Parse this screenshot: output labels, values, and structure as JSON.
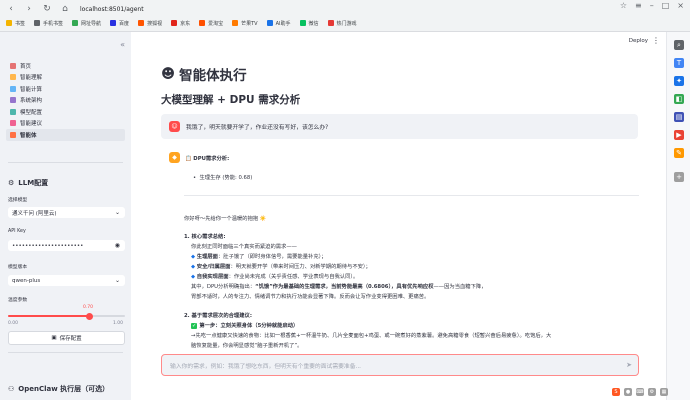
{
  "browser": {
    "url": "localhost:8501/agent",
    "bookmarks": [
      {
        "label": "书签",
        "color": "#f4b400"
      },
      {
        "label": "手机书签",
        "color": "#5f6368"
      },
      {
        "label": "网址导航",
        "color": "#34a853"
      },
      {
        "label": "百度",
        "color": "#2932e1"
      },
      {
        "label": "搜狐视",
        "color": "#ff5500"
      },
      {
        "label": "京东",
        "color": "#e1251b"
      },
      {
        "label": "爱淘宝",
        "color": "#ff5000"
      },
      {
        "label": "芒果TV",
        "color": "#ff7a00"
      },
      {
        "label": "AI助手",
        "color": "#1a73e8"
      },
      {
        "label": "微信",
        "color": "#07c160"
      },
      {
        "label": "热门游戏",
        "color": "#e53935"
      }
    ]
  },
  "sidebar": {
    "nav": [
      {
        "label": "首页",
        "color": "#e57373"
      },
      {
        "label": "智能理解",
        "color": "#ffb74d"
      },
      {
        "label": "智能计算",
        "color": "#64b5f6"
      },
      {
        "label": "系统架构",
        "color": "#9575cd"
      },
      {
        "label": "模型配置",
        "color": "#4db6ac"
      },
      {
        "label": "智能建议",
        "color": "#f06292"
      },
      {
        "label": "智能体",
        "color": "#ff7043"
      }
    ],
    "llm_title": "LLM配置",
    "model_label": "选择模型",
    "model_value": "通义千问 (阿里云)",
    "apikey_label": "API Key",
    "apikey_value": "••••••••••••••••••••••",
    "version_label": "模型版本",
    "version_value": "qwen-plus",
    "temp_label": "温度参数",
    "temp_value": "0.70",
    "temp_min": "0.00",
    "temp_max": "1.00",
    "temp_fraction": 0.7,
    "save_label": "保存配置",
    "openclaw_title": "OpenClaw 执行层（可选）"
  },
  "header": {
    "deploy_label": "Deploy"
  },
  "main": {
    "title": "智能体执行",
    "subtitle": "大模型理解 + DPU 需求分析",
    "user_message": "我饿了，明天就要开学了，作业还没有写好，该怎么办?",
    "dpu_heading": "DPU需求分析:",
    "dpu_item": "生理生存 (势能: 0.68)",
    "greeting": "你好呀～先给你一个温暖的抱抱 ☀️",
    "core_heading": "核心需求总结:",
    "core_intro": "你此刻正同时面临三个真实而紧迫的需求——",
    "core_item1_label": "生理层面",
    "core_item1_text": "：肚子饿了（即时身体信号，需要能量补充）；",
    "core_item2_label": "安全/归属层面",
    "core_item2_text": "：明天就要开学（带来时间压力、对新学期的期待与不安）；",
    "core_item3_label": "自我实现层面",
    "core_item3_text": "：作业尚未完成（关乎责任感、学业表现与自我认同）。",
    "core_conclusion_pre": "其中，DPU分析明确指出：",
    "core_conclusion_bold": "“饥饿”作为最基础的生理需求，当前势能最高（0.6806），具有优先响应权",
    "core_conclusion_post": "——因为当血糖下降，",
    "core_conclusion_2": "胃部不适时，人的专注力、情绪调节力和执行功能会显著下降。反而会让写作业变得更困难、更痛苦。",
    "steps_heading": "基于需求层次的合理建议:",
    "step1_label": "第一步：立刻关照身体（5分钟就能启动）",
    "step1_text1": "→先吃一点健康又快速的食物：比如一根香蕉+一杯温牛奶、几片全麦面包+鸡蛋、或一碗煮好的蒸紫薯。避免高糖零食（短暂兴奋后易疲惫）。吃饱后，大",
    "step1_text2": "脑恢复能量，你会明显感觉“脑子重新开机了”。",
    "input_placeholder": "输入你的需求，例如：我饿了想吃东西，但明天有个重要的面试需要准备..."
  }
}
